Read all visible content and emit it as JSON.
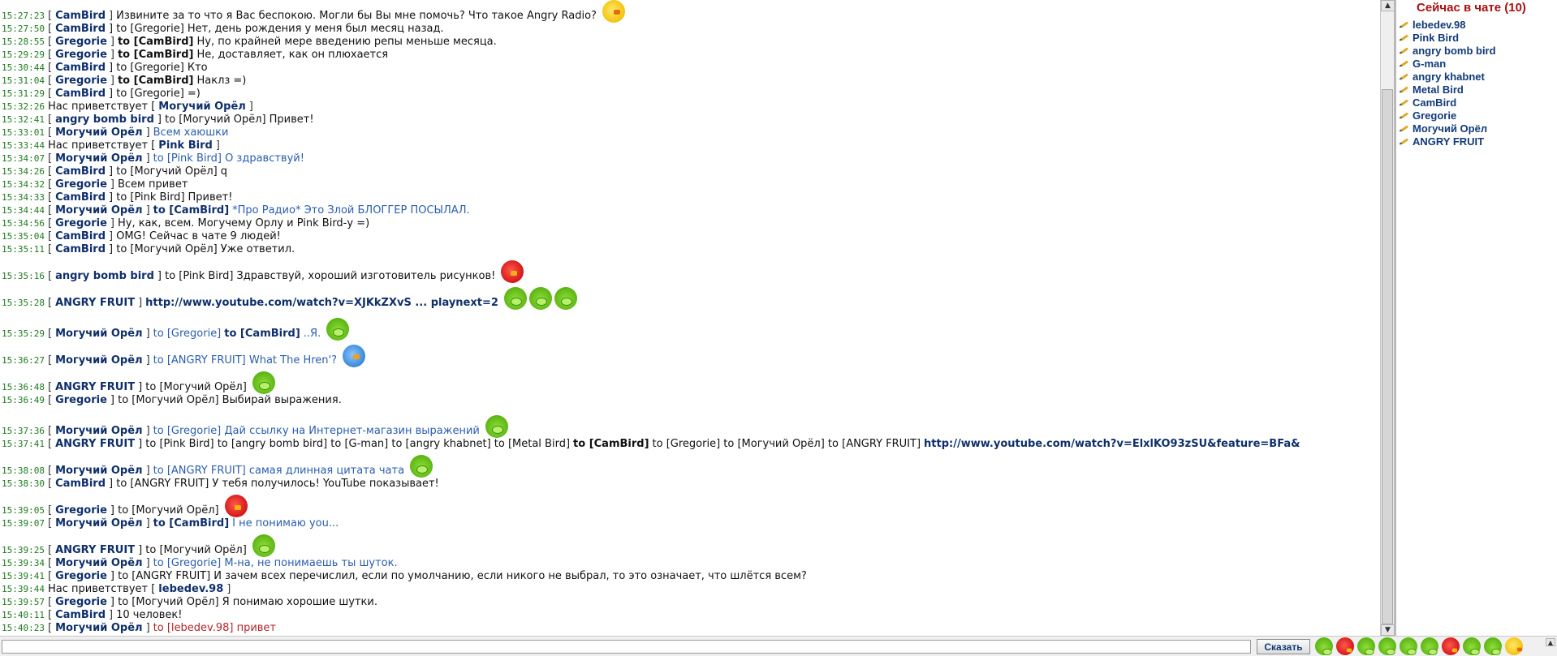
{
  "chat": {
    "messages": [
      {
        "ts": "15:27:23",
        "size": "",
        "parts": [
          {
            "t": "[",
            "c": "br"
          },
          {
            "t": "CamBird",
            "c": "nick"
          },
          {
            "t": "]",
            "c": "br"
          },
          {
            "t": "Извините за то что я Вас беспокою. Могли бы Вы мне помочь? Что такое Angry Radio?",
            "c": "plain"
          }
        ],
        "emoticons": [
          "yellow-bird"
        ]
      },
      {
        "ts": "15:27:50",
        "size": "",
        "parts": [
          {
            "t": "[",
            "c": "br"
          },
          {
            "t": "CamBird",
            "c": "nick"
          },
          {
            "t": "] to [Gregorie]",
            "c": "to"
          },
          {
            "t": "Нет, день рождения у меня был месяц назад.",
            "c": "plain"
          }
        ],
        "emoticons": []
      },
      {
        "ts": "15:28:55",
        "size": "",
        "parts": [
          {
            "t": "[",
            "c": "br"
          },
          {
            "t": "Gregorie",
            "c": "nick"
          },
          {
            "t": "]",
            "c": "br"
          },
          {
            "t": "to [CamBird]",
            "c": "bold"
          },
          {
            "t": "Ну, по крайней мере введению репы меньше месяца.",
            "c": "plain"
          }
        ],
        "emoticons": []
      },
      {
        "ts": "15:29:29",
        "size": "",
        "parts": [
          {
            "t": "[",
            "c": "br"
          },
          {
            "t": "Gregorie",
            "c": "nick"
          },
          {
            "t": "]",
            "c": "br"
          },
          {
            "t": "to [CamBird]",
            "c": "bold"
          },
          {
            "t": "Не, доставляет, как он плюхается",
            "c": "plain"
          }
        ],
        "emoticons": []
      },
      {
        "ts": "15:30:44",
        "size": "",
        "parts": [
          {
            "t": "[",
            "c": "br"
          },
          {
            "t": "CamBird",
            "c": "nick"
          },
          {
            "t": "] to [Gregorie]",
            "c": "to"
          },
          {
            "t": "Кто",
            "c": "plain"
          }
        ],
        "emoticons": []
      },
      {
        "ts": "15:31:04",
        "size": "",
        "parts": [
          {
            "t": "[",
            "c": "br"
          },
          {
            "t": "Gregorie",
            "c": "nick"
          },
          {
            "t": "]",
            "c": "br"
          },
          {
            "t": "to [CamBird]",
            "c": "bold"
          },
          {
            "t": "Наклз =)",
            "c": "plain"
          }
        ],
        "emoticons": []
      },
      {
        "ts": "15:31:29",
        "size": "",
        "parts": [
          {
            "t": "[",
            "c": "br"
          },
          {
            "t": "CamBird",
            "c": "nick"
          },
          {
            "t": "] to [Gregorie]",
            "c": "to"
          },
          {
            "t": "=)",
            "c": "plain"
          }
        ],
        "emoticons": []
      },
      {
        "ts": "15:32:26",
        "size": "",
        "parts": [
          {
            "t": "Нас приветствует [",
            "c": "plain"
          },
          {
            "t": "Могучий Орёл",
            "c": "nick"
          },
          {
            "t": "]",
            "c": "br"
          }
        ],
        "emoticons": []
      },
      {
        "ts": "15:32:41",
        "size": "",
        "parts": [
          {
            "t": "[",
            "c": "br"
          },
          {
            "t": "angry bomb bird",
            "c": "nick"
          },
          {
            "t": "] to [Могучий Орёл]",
            "c": "to"
          },
          {
            "t": "Привет!",
            "c": "plain"
          }
        ],
        "emoticons": []
      },
      {
        "ts": "15:33:01",
        "size": "",
        "parts": [
          {
            "t": "[",
            "c": "br"
          },
          {
            "t": "Могучий Орёл",
            "c": "nick"
          },
          {
            "t": "]",
            "c": "br"
          },
          {
            "t": "Всем хаюшки",
            "c": "blue"
          }
        ],
        "emoticons": []
      },
      {
        "ts": "15:33:44",
        "size": "",
        "parts": [
          {
            "t": "Нас приветствует [",
            "c": "plain"
          },
          {
            "t": "Pink Bird",
            "c": "nick"
          },
          {
            "t": "]",
            "c": "br"
          }
        ],
        "emoticons": []
      },
      {
        "ts": "15:34:07",
        "size": "",
        "parts": [
          {
            "t": "[",
            "c": "br"
          },
          {
            "t": "Могучий Орёл",
            "c": "nick"
          },
          {
            "t": "]",
            "c": "br"
          },
          {
            "t": "to [Pink Bird] О здравствуй!",
            "c": "blue"
          }
        ],
        "emoticons": []
      },
      {
        "ts": "15:34:26",
        "size": "",
        "parts": [
          {
            "t": "[",
            "c": "br"
          },
          {
            "t": "CamBird",
            "c": "nick"
          },
          {
            "t": "] to [Могучий Орёл]",
            "c": "to"
          },
          {
            "t": "q",
            "c": "plain"
          }
        ],
        "emoticons": []
      },
      {
        "ts": "15:34:32",
        "size": "",
        "parts": [
          {
            "t": "[",
            "c": "br"
          },
          {
            "t": "Gregorie",
            "c": "nick"
          },
          {
            "t": "]",
            "c": "br"
          },
          {
            "t": "Всем привет",
            "c": "plain"
          }
        ],
        "emoticons": []
      },
      {
        "ts": "15:34:33",
        "size": "",
        "parts": [
          {
            "t": "[",
            "c": "br"
          },
          {
            "t": "CamBird",
            "c": "nick"
          },
          {
            "t": "] to [Pink Bird]",
            "c": "to"
          },
          {
            "t": "Привет!",
            "c": "plain"
          }
        ],
        "emoticons": []
      },
      {
        "ts": "15:34:44",
        "size": "",
        "parts": [
          {
            "t": "[",
            "c": "br"
          },
          {
            "t": "Могучий Орёл",
            "c": "nick"
          },
          {
            "t": "]",
            "c": "br"
          },
          {
            "t": "to [CamBird]",
            "c": "nick"
          },
          {
            "t": "*Про Радио* Это Злой БЛОГГЕР ПОСЫЛАЛ.",
            "c": "blue"
          }
        ],
        "emoticons": []
      },
      {
        "ts": "15:34:56",
        "size": "",
        "parts": [
          {
            "t": "[",
            "c": "br"
          },
          {
            "t": "Gregorie",
            "c": "nick"
          },
          {
            "t": "]",
            "c": "br"
          },
          {
            "t": "Ну, как, всем. Могучему Орлу и Pink Bird-у =)",
            "c": "plain"
          }
        ],
        "emoticons": []
      },
      {
        "ts": "15:35:04",
        "size": "",
        "parts": [
          {
            "t": "[",
            "c": "br"
          },
          {
            "t": "CamBird",
            "c": "nick"
          },
          {
            "t": "]",
            "c": "br"
          },
          {
            "t": "OMG! Сейчас в чате 9 людей!",
            "c": "plain"
          }
        ],
        "emoticons": []
      },
      {
        "ts": "15:35:11",
        "size": "",
        "parts": [
          {
            "t": "[",
            "c": "br"
          },
          {
            "t": "CamBird",
            "c": "nick"
          },
          {
            "t": "] to [Могучий Орёл]",
            "c": "to"
          },
          {
            "t": "Уже ответил.",
            "c": "plain"
          }
        ],
        "emoticons": []
      },
      {
        "ts": "15:35:16",
        "size": "tall",
        "parts": [
          {
            "t": "[",
            "c": "br"
          },
          {
            "t": "angry bomb bird",
            "c": "nick"
          },
          {
            "t": "] to [Pink Bird]",
            "c": "to"
          },
          {
            "t": "Здравствуй, хороший изготовитель рисунков!",
            "c": "plain"
          }
        ],
        "emoticons": [
          "red-bird"
        ]
      },
      {
        "ts": "15:35:28",
        "size": "tall",
        "parts": [
          {
            "t": "[",
            "c": "br"
          },
          {
            "t": "ANGRY FRUIT",
            "c": "nick"
          },
          {
            "t": "]",
            "c": "br"
          },
          {
            "t": "http://www.youtube.com/watch?v=XJKkZXvS ... playnext=2",
            "c": "link"
          }
        ],
        "emoticons": [
          "pig",
          "pig",
          "pig"
        ]
      },
      {
        "ts": "15:35:29",
        "size": "tall2",
        "parts": [
          {
            "t": "[",
            "c": "br"
          },
          {
            "t": "Могучий Орёл",
            "c": "nick"
          },
          {
            "t": "]",
            "c": "br"
          },
          {
            "t": "to [Gregorie]",
            "c": "blue"
          },
          {
            "t": "to [CamBird]",
            "c": "nick"
          },
          {
            "t": "..Я.",
            "c": "blue"
          }
        ],
        "emoticons": [
          "pig"
        ]
      },
      {
        "ts": "15:36:27",
        "size": "tall",
        "parts": [
          {
            "t": "[",
            "c": "br"
          },
          {
            "t": "Могучий Орёл",
            "c": "nick"
          },
          {
            "t": "]",
            "c": "br"
          },
          {
            "t": "to [ANGRY FRUIT] What The Hren'?",
            "c": "blue"
          }
        ],
        "emoticons": [
          "blue-bird"
        ]
      },
      {
        "ts": "15:36:48",
        "size": "tall",
        "parts": [
          {
            "t": "[",
            "c": "br"
          },
          {
            "t": "ANGRY FRUIT",
            "c": "nick"
          },
          {
            "t": "] to [Могучий Орёл]",
            "c": "to"
          }
        ],
        "emoticons": [
          "pig"
        ]
      },
      {
        "ts": "15:36:49",
        "size": "",
        "parts": [
          {
            "t": "[",
            "c": "br"
          },
          {
            "t": "Gregorie",
            "c": "nick"
          },
          {
            "t": "] to [Могучий Орёл]",
            "c": "to"
          },
          {
            "t": "Выбирай выражения.",
            "c": "plain"
          }
        ],
        "emoticons": []
      },
      {
        "ts": "15:37:36",
        "size": "tall2",
        "parts": [
          {
            "t": "[",
            "c": "br"
          },
          {
            "t": "Могучий Орёл",
            "c": "nick"
          },
          {
            "t": "]",
            "c": "br"
          },
          {
            "t": "to [Gregorie] Дай ссылку на Интернет-магазин выражений",
            "c": "blue"
          }
        ],
        "emoticons": [
          "pig"
        ]
      },
      {
        "ts": "15:37:41",
        "size": "",
        "parts": [
          {
            "t": "[",
            "c": "br"
          },
          {
            "t": "ANGRY FRUIT",
            "c": "nick"
          },
          {
            "t": "] to [Pink Bird] to [angry bomb bird] to [G-man] to [angry khabnet] to [Metal Bird]",
            "c": "to"
          },
          {
            "t": "to [CamBird]",
            "c": "bold"
          },
          {
            "t": "to [Gregorie] to [Могучий Орёл] to [ANGRY FRUIT]",
            "c": "to"
          },
          {
            "t": "http://www.youtube.com/watch?v=ElxlKO93zSU&feature=BFa&",
            "c": "link"
          }
        ],
        "emoticons": []
      },
      {
        "ts": "15:38:08",
        "size": "tall",
        "parts": [
          {
            "t": "[",
            "c": "br"
          },
          {
            "t": "Могучий Орёл",
            "c": "nick"
          },
          {
            "t": "]",
            "c": "br"
          },
          {
            "t": "to [ANGRY FRUIT] самая длинная цитата чата",
            "c": "blue"
          }
        ],
        "emoticons": [
          "pig"
        ]
      },
      {
        "ts": "15:38:30",
        "size": "",
        "parts": [
          {
            "t": "[",
            "c": "br"
          },
          {
            "t": "CamBird",
            "c": "nick"
          },
          {
            "t": "] to [ANGRY FRUIT]",
            "c": "to"
          },
          {
            "t": "У тебя получилось! YouTube показывает!",
            "c": "plain"
          }
        ],
        "emoticons": []
      },
      {
        "ts": "15:39:05",
        "size": "tall",
        "parts": [
          {
            "t": "[",
            "c": "br"
          },
          {
            "t": "Gregorie",
            "c": "nick"
          },
          {
            "t": "] to [Могучий Орёл]",
            "c": "to"
          }
        ],
        "emoticons": [
          "red-bird"
        ]
      },
      {
        "ts": "15:39:07",
        "size": "",
        "parts": [
          {
            "t": "[",
            "c": "br"
          },
          {
            "t": "Могучий Орёл",
            "c": "nick"
          },
          {
            "t": "]",
            "c": "br"
          },
          {
            "t": "to [CamBird]",
            "c": "nick"
          },
          {
            "t": "I не понимаю you...",
            "c": "blue"
          }
        ],
        "emoticons": []
      },
      {
        "ts": "15:39:25",
        "size": "tall",
        "parts": [
          {
            "t": "[",
            "c": "br"
          },
          {
            "t": "ANGRY FRUIT",
            "c": "nick"
          },
          {
            "t": "] to [Могучий Орёл]",
            "c": "to"
          }
        ],
        "emoticons": [
          "pig"
        ]
      },
      {
        "ts": "15:39:34",
        "size": "",
        "parts": [
          {
            "t": "[",
            "c": "br"
          },
          {
            "t": "Могучий Орёл",
            "c": "nick"
          },
          {
            "t": "]",
            "c": "br"
          },
          {
            "t": "to [Gregorie] М-на, не понимаешь ты шуток.",
            "c": "blue"
          }
        ],
        "emoticons": []
      },
      {
        "ts": "15:39:41",
        "size": "",
        "parts": [
          {
            "t": "[",
            "c": "br"
          },
          {
            "t": "Gregorie",
            "c": "nick"
          },
          {
            "t": "] to [ANGRY FRUIT]",
            "c": "to"
          },
          {
            "t": "И зачем всех перечислил, если по умолчанию, если никого не выбрал, то это означает, что шлётся всем?",
            "c": "plain"
          }
        ],
        "emoticons": []
      },
      {
        "ts": "15:39:44",
        "size": "",
        "parts": [
          {
            "t": "Нас приветствует [",
            "c": "plain"
          },
          {
            "t": "lebedev.98",
            "c": "nick"
          },
          {
            "t": "]",
            "c": "br"
          }
        ],
        "emoticons": []
      },
      {
        "ts": "15:39:57",
        "size": "",
        "parts": [
          {
            "t": "[",
            "c": "br"
          },
          {
            "t": "Gregorie",
            "c": "nick"
          },
          {
            "t": "] to [Могучий Орёл]",
            "c": "to"
          },
          {
            "t": "Я понимаю хорошие шутки.",
            "c": "plain"
          }
        ],
        "emoticons": []
      },
      {
        "ts": "15:40:11",
        "size": "",
        "parts": [
          {
            "t": "[",
            "c": "br"
          },
          {
            "t": "CamBird",
            "c": "nick"
          },
          {
            "t": "]",
            "c": "br"
          },
          {
            "t": "10 человек!",
            "c": "plain"
          }
        ],
        "emoticons": []
      },
      {
        "ts": "15:40:23",
        "size": "",
        "parts": [
          {
            "t": "[",
            "c": "br"
          },
          {
            "t": "Могучий Орёл",
            "c": "nick"
          },
          {
            "t": "]",
            "c": "br"
          },
          {
            "t": "to [lebedev.98] привет",
            "c": "red"
          }
        ],
        "emoticons": []
      }
    ]
  },
  "users_panel": {
    "title": "Сейчас в чате (10)",
    "users": [
      "lebedev.98",
      "Pink Bird",
      "angry bomb bird",
      "G-man",
      "angry khabnet",
      "Metal Bird",
      "CamBird",
      "Gregorie",
      "Могучий Орёл",
      "ANGRY FRUIT"
    ]
  },
  "input": {
    "value": "",
    "placeholder": "",
    "say_label": "Сказать"
  },
  "emoticon_bar": [
    "pig",
    "red-bird",
    "pig",
    "pig",
    "pig",
    "pig",
    "red-bird",
    "pig",
    "pig",
    "yellow-bird"
  ],
  "colors": {
    "timestamp": "#1d7a1d",
    "nick": "#0f2f6b",
    "blue_message": "#2a5db0",
    "red_message": "#b3262a",
    "panel_title": "#aa1111"
  }
}
